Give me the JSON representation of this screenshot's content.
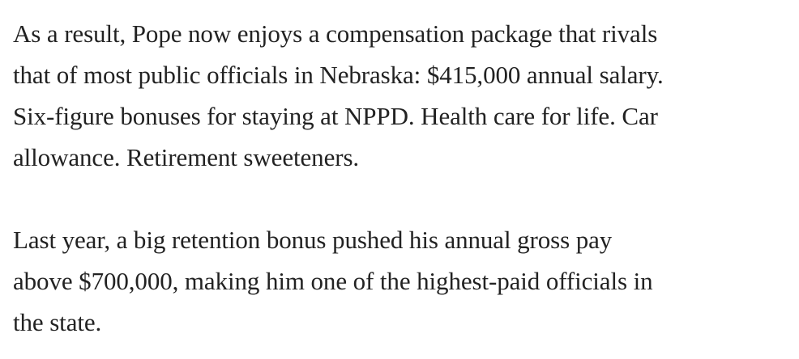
{
  "article": {
    "paragraphs": [
      {
        "lines": [
          "As a result, Pope now enjoys a compensation package that rivals",
          "that of most public officials in Nebraska: $415,000 annual salary.",
          "Six-figure bonuses for staying at NPPD. Health care for life. Car",
          "allowance. Retirement sweeteners."
        ]
      },
      {
        "lines": [
          "Last year, a big retention bonus pushed his annual gross pay",
          "above $700,000, making him one of the highest-paid officials in",
          "the state."
        ]
      }
    ]
  }
}
